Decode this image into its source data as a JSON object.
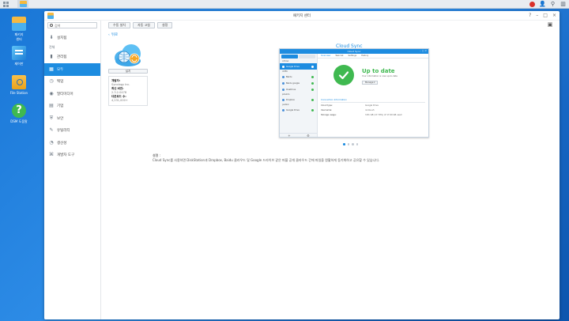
{
  "taskbar": {
    "notification_count": ""
  },
  "desktop": {
    "icons": [
      {
        "label": "패키지\n센터"
      },
      {
        "label": "제어판"
      },
      {
        "label": "File Station"
      },
      {
        "label": "DSM 도움말"
      }
    ]
  },
  "window": {
    "title": "패키지 센터"
  },
  "sidebar": {
    "search_placeholder": "검색",
    "installed": "설치됨",
    "all_section": "전체",
    "items": [
      {
        "label": "관리됨"
      },
      {
        "label": "모두"
      },
      {
        "label": "백업"
      },
      {
        "label": "멀티미디어"
      },
      {
        "label": "기업"
      },
      {
        "label": "보안"
      },
      {
        "label": "유틸리티"
      },
      {
        "label": "생산성"
      },
      {
        "label": "개발자 도구"
      }
    ]
  },
  "toolbar": {
    "manual_install": "수동 설치",
    "manual_update": "자동 고침",
    "settings": "설정"
  },
  "back_link": "뒤로",
  "package": {
    "install_label": "설치",
    "developer_label": "개발자:",
    "developer_value": "Synology Inc.",
    "version_label": "최신 버전:",
    "version_value": "2.3.2-0478",
    "downloads_label": "다운로드 수:",
    "downloads_value": "4,231,000+"
  },
  "hero": {
    "title": "Cloud Sync",
    "shot": {
      "title": "Cloud Sync",
      "groups": [
        "cdhcw",
        "driftb",
        "pdekdo",
        "justink"
      ],
      "rows": [
        {
          "label": "Google Drive"
        },
        {
          "label": "Baidu"
        },
        {
          "label": "Baidu google"
        },
        {
          "label": "OneDrive"
        },
        {
          "label": "Dropbox"
        },
        {
          "label": "Google Drive"
        }
      ],
      "tabs": [
        "Overview",
        "Task list",
        "Settings",
        "History"
      ],
      "status": "Up to date",
      "status_sub": "Your information is now up-to-date",
      "manage": "Manage ▾",
      "conn_head": "Connection Information",
      "conn": [
        {
          "k": "Cloud type:",
          "v": "Google Drive"
        },
        {
          "k": "Username:",
          "v": "nicole.sh"
        },
        {
          "k": "Storage usage:",
          "v": "3.81 GB (17.79%) of 17.00 GB used"
        }
      ]
    }
  },
  "carousel": {
    "pages": 4,
    "active": 0
  },
  "description": {
    "title": "설명 :",
    "text": "Cloud Sync를 사용하면 DiskStation과 Dropbox, Baidu 클라우드 및 Google 드라이브 같은 퍼블 공개 클라우드 간에 파일을 원활하게 동기화하고 공유할 수 있습니다."
  },
  "colors": {
    "accent": "#1d8ce0",
    "ok": "#3fb950"
  }
}
